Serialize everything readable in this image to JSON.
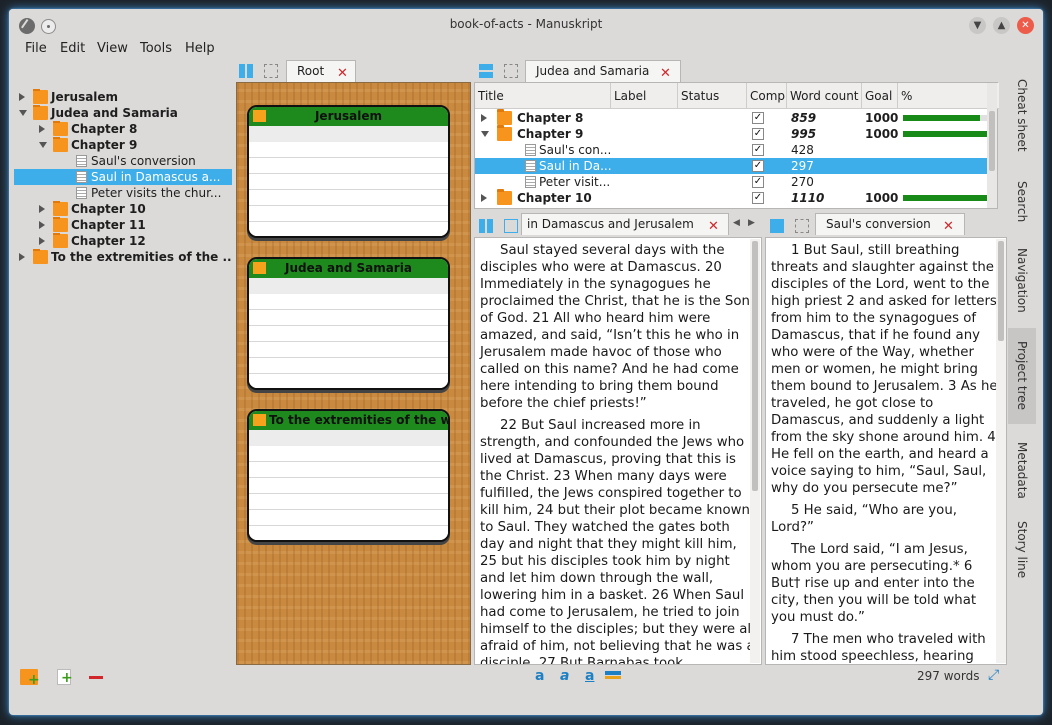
{
  "window": {
    "title": "book-of-acts - Manuskript"
  },
  "menu": [
    "File",
    "Edit",
    "View",
    "Tools",
    "Help"
  ],
  "tree": [
    {
      "label": "Jerusalem",
      "bold": true,
      "level": 0,
      "expanded": false,
      "type": "folder"
    },
    {
      "label": "Judea and Samaria",
      "bold": true,
      "level": 0,
      "expanded": true,
      "type": "folder"
    },
    {
      "label": "Chapter 8",
      "bold": true,
      "level": 1,
      "expanded": false,
      "type": "folder"
    },
    {
      "label": "Chapter 9",
      "bold": true,
      "level": 1,
      "expanded": true,
      "type": "folder"
    },
    {
      "label": "Saul's conversion",
      "bold": false,
      "level": 2,
      "type": "doc"
    },
    {
      "label": "Saul in Damascus a...",
      "bold": false,
      "level": 2,
      "type": "doc",
      "selected": true
    },
    {
      "label": "Peter visits the chur...",
      "bold": false,
      "level": 2,
      "type": "doc"
    },
    {
      "label": "Chapter 10",
      "bold": true,
      "level": 1,
      "expanded": false,
      "type": "folder"
    },
    {
      "label": "Chapter 11",
      "bold": true,
      "level": 1,
      "expanded": false,
      "type": "folder"
    },
    {
      "label": "Chapter 12",
      "bold": true,
      "level": 1,
      "expanded": false,
      "type": "folder"
    },
    {
      "label": "To the extremities of the ...",
      "bold": true,
      "level": 0,
      "expanded": false,
      "type": "folder"
    }
  ],
  "corkboard": {
    "tab": "Root",
    "cards": [
      "Jerusalem",
      "Judea and Samaria",
      "To the extremities of the w..."
    ]
  },
  "outline": {
    "tab": "Judea and Samaria",
    "headers": [
      "Title",
      "Label",
      "Status",
      "Comp",
      "Word count",
      "Goal",
      "%"
    ],
    "rows": [
      {
        "title": "Chapter 8",
        "type": "folder",
        "level": 0,
        "bold": true,
        "comp": true,
        "words": "859",
        "goal": "1000",
        "pct": 0.86
      },
      {
        "title": "Chapter 9",
        "type": "folder",
        "level": 0,
        "bold": true,
        "expanded": true,
        "comp": true,
        "words": "995",
        "goal": "1000",
        "pct": 0.995
      },
      {
        "title": "Saul's con...",
        "type": "doc",
        "level": 1,
        "comp": true,
        "words": "428",
        "goal": "",
        "pct": null
      },
      {
        "title": "Saul in Da...",
        "type": "doc",
        "level": 1,
        "comp": true,
        "words": "297",
        "goal": "",
        "pct": null,
        "selected": true
      },
      {
        "title": "Peter visit...",
        "type": "doc",
        "level": 1,
        "comp": true,
        "words": "270",
        "goal": "",
        "pct": null
      },
      {
        "title": "Chapter 10",
        "type": "folder",
        "level": 0,
        "bold": true,
        "comp": true,
        "words": "1110",
        "goal": "1000",
        "pct": 1.0
      }
    ]
  },
  "editor_left": {
    "tab": "in Damascus and Jerusalem",
    "paragraphs": [
      "Saul stayed several days with the disciples who were at Damascus. 20 Immediately in the synagogues he proclaimed the Christ, that he is the Son of God. 21 All who heard him were amazed, and said, “Isn’t this he who in Jerusalem made havoc of those who called on this name? And he had come here intending to bring them bound before the chief priests!”",
      "22 But Saul increased more in strength, and confounded the Jews who lived at Damascus, proving that this is the Christ. 23 When many days were fulfilled, the Jews conspired together to kill him, 24 but their plot became known to Saul. They watched the gates both day and night that they might kill him, 25 but his disciples took him by night and let him down through the wall, lowering him in a basket. 26 When Saul had come to Jerusalem, he tried to join himself to the disciples; but they were all afraid of him, not believing that he was a disciple. 27 But Barnabas took"
    ]
  },
  "editor_right": {
    "tab": "Saul's conversion",
    "paragraphs": [
      "1 But Saul, still breathing threats and slaughter against the disciples of the Lord, went to the high priest 2 and asked for letters from him to the synagogues of Damascus, that if he found any who were of the Way, whether men or women, he might bring them bound to Jerusalem. 3 As he traveled, he got close to Damascus, and suddenly a light from the sky shone around him. 4 He fell on the earth, and heard a voice saying to him, “Saul, Saul, why do you persecute me?”",
      "5 He said, “Who are you, Lord?”",
      "The Lord said, “I am Jesus, whom you are persecuting.* 6 But† rise up and enter into the city, then you will be told what you must do.”",
      "7 The men who traveled with him stood speechless, hearing"
    ]
  },
  "status": {
    "words": "297 words"
  },
  "side_tabs": [
    "Cheat sheet",
    "Search",
    "Navigation",
    "Project tree",
    "Metadata",
    "Story line"
  ],
  "colors": {
    "accent": "#3daee9",
    "card_header": "#1e8a1e",
    "folder": "#f7941d",
    "close": "#d3262a"
  }
}
